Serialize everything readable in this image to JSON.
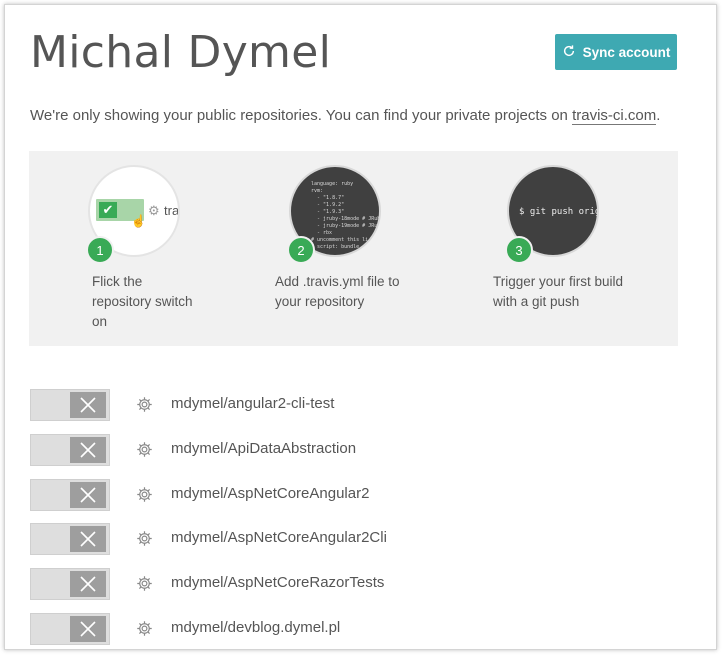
{
  "header": {
    "title": "Michal Dymel",
    "sync_label": "Sync account"
  },
  "notice": {
    "text": "We're only showing your public repositories. You can find your private projects on ",
    "link": "travis-ci.com",
    "end": "."
  },
  "steps": [
    {
      "number": "1",
      "text": "Flick the repository switch on",
      "lines": [
        "Flick the",
        "repository switch",
        "on"
      ],
      "preview_text": "tra"
    },
    {
      "number": "2",
      "text": "Add .travis.yml file to your repository",
      "lines": [
        "Add .travis.yml file to",
        "your repository"
      ],
      "code": "language: ruby\nrvm:\n  - \"1.8.7\"\n  - \"1.9.2\"\n  - \"1.9.3\"\n  - jruby-18mode # JRuby\n  - jruby-19mode # JRuby\n  - rbx\n# uncomment this li\n# script: bundle"
    },
    {
      "number": "3",
      "text": "Trigger your first build with a git push",
      "lines": [
        "Trigger your first build",
        "with a git push"
      ],
      "command": "$ git push origin"
    }
  ],
  "repositories": [
    "mdymel/angular2-cli-test",
    "mdymel/ApiDataAbstraction",
    "mdymel/AspNetCoreAngular2",
    "mdymel/AspNetCoreAngular2Cli",
    "mdymel/AspNetCoreRazorTests",
    "mdymel/devblog.dymel.pl"
  ],
  "colors": {
    "accent": "#3ea9b2",
    "step_number": "#39aa56",
    "toggle_off": "#dedede"
  }
}
